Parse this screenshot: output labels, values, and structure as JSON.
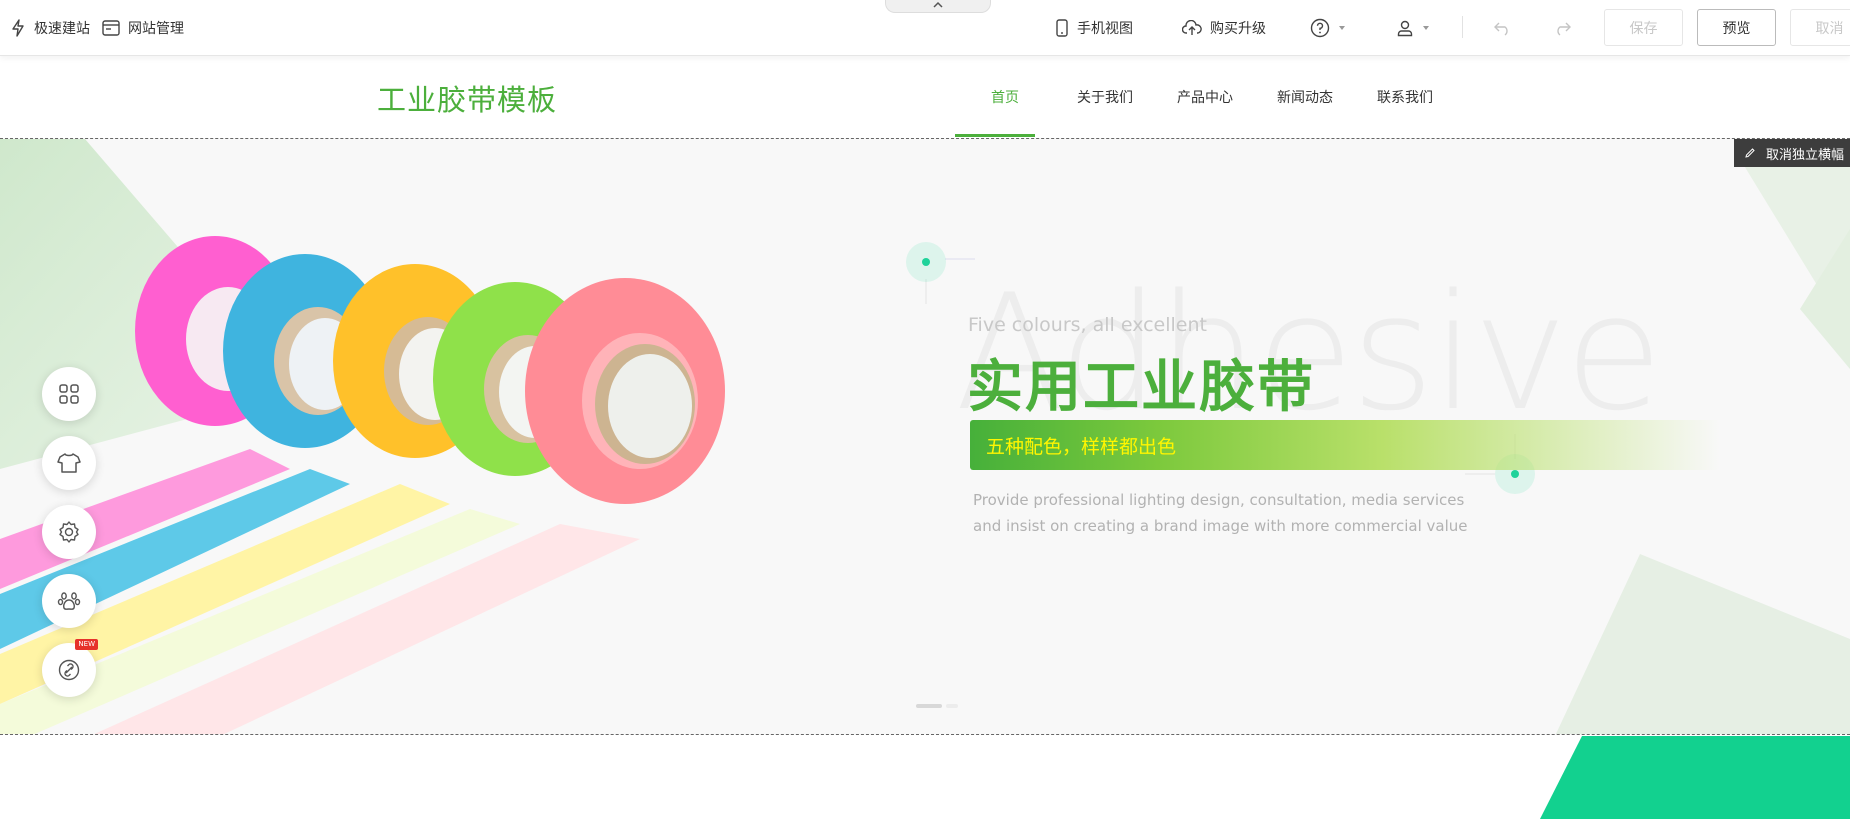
{
  "toolbar": {
    "quick_build": "极速建站",
    "site_manage": "网站管理",
    "mobile_view": "手机视图",
    "upgrade": "购买升级",
    "save": "保存",
    "preview": "预览",
    "cancel": "取消"
  },
  "site": {
    "logo": "工业胶带模板",
    "nav": [
      "首页",
      "关于我们",
      "产品中心",
      "新闻动态",
      "联系我们"
    ],
    "active_nav": 0
  },
  "banner": {
    "edit_badge": "取消独立横幅",
    "bg_word": "Adhesive",
    "subtitle": "Five colours, all excellent",
    "title": "实用工业胶带",
    "strip": "五种配色，样样都出色",
    "description": "Provide professional lighting design, consultation, media services and insist on creating a brand image with more commercial value"
  },
  "side_tools": [
    {
      "icon": "grid-icon"
    },
    {
      "icon": "shirt-icon"
    },
    {
      "icon": "gear-icon"
    },
    {
      "icon": "paw-icon"
    },
    {
      "icon": "link-icon",
      "tag": "NEW"
    }
  ],
  "colors": {
    "brand_green": "#4caf3c",
    "accent_teal": "#1fd29a",
    "strip_text": "#fff600"
  }
}
